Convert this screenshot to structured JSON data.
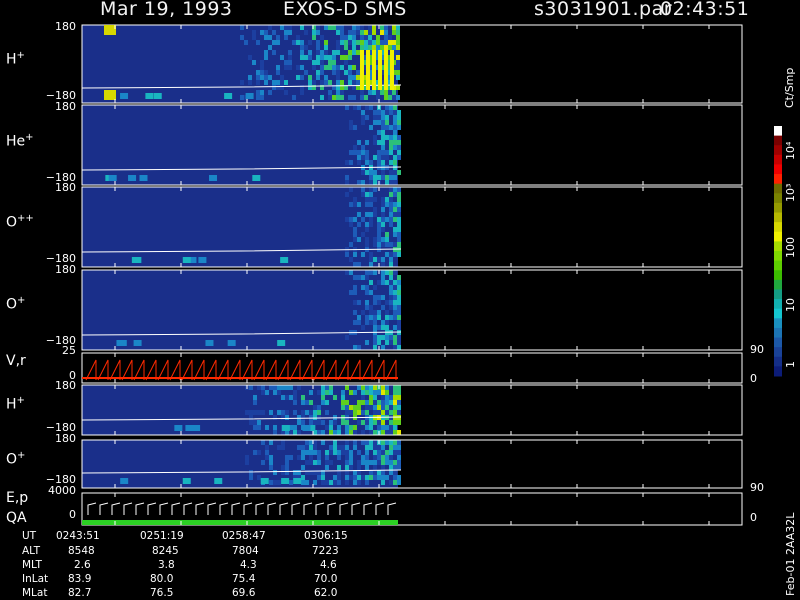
{
  "header": {
    "date": "Mar 19, 1993",
    "instrument": "EXOS-D SMS",
    "file": "s3031901.par",
    "time": "02:43:51"
  },
  "panels": [
    {
      "label": "H",
      "sup": "+",
      "top_tick": "180",
      "bottom_tick": "−180"
    },
    {
      "label": "He",
      "sup": "+",
      "top_tick": "180",
      "bottom_tick": "−180"
    },
    {
      "label": "O",
      "sup": "++",
      "top_tick": "180",
      "bottom_tick": "−180"
    },
    {
      "label": "O",
      "sup": "+",
      "top_tick": "180",
      "bottom_tick": "−180"
    },
    {
      "label": "V,r",
      "sup": "",
      "top_tick": "25",
      "bottom_tick": "0",
      "right_top": "90",
      "right_bottom": "0"
    },
    {
      "label": "H",
      "sup": "+",
      "top_tick": "180",
      "bottom_tick": "−180"
    },
    {
      "label": "O",
      "sup": "+",
      "top_tick": "180",
      "bottom_tick": "−180"
    },
    {
      "label": "E,p",
      "label2": "QA",
      "sup": "",
      "top_tick": "4000",
      "bottom_tick": "0",
      "right_top": "90",
      "right_bottom": "0"
    }
  ],
  "colorbar": {
    "unit": "Ct/Smp",
    "labels": [
      "10⁴",
      "10³",
      "100",
      "10",
      "1"
    ],
    "colors": [
      "#ffffff",
      "#7a0000",
      "#a00000",
      "#c80000",
      "#f00000",
      "#ff2000",
      "#6e6b00",
      "#7a8200",
      "#949a00",
      "#b6b800",
      "#d7d800",
      "#f0f000",
      "#a6dc00",
      "#80d800",
      "#5ece00",
      "#3cbc00",
      "#20a83e",
      "#149c84",
      "#12b0b0",
      "#14c6d0",
      "#1a90c0",
      "#1c74b4",
      "#1c58a8",
      "#1a4298",
      "#142e88",
      "#0c1c78"
    ]
  },
  "right_tag": "Feb-01 2AA32L",
  "footer": {
    "rows": [
      {
        "label": "UT",
        "values": [
          "0243:51",
          "0251:19",
          "0258:47",
          "0306:15"
        ]
      },
      {
        "label": "ALT",
        "values": [
          "8548",
          "8245",
          "7804",
          "7223"
        ]
      },
      {
        "label": "MLT",
        "values": [
          "2.6",
          "3.8",
          "4.3",
          "4.6"
        ]
      },
      {
        "label": "InLat",
        "values": [
          "83.9",
          "80.0",
          "75.4",
          "70.0"
        ]
      },
      {
        "label": "MLat",
        "values": [
          "82.7",
          "76.5",
          "69.6",
          "62.0"
        ]
      }
    ]
  },
  "chart_data": {
    "type": "heatmap",
    "x": [
      "0243:51",
      "0251:19",
      "0258:47",
      "0306:15"
    ],
    "spectrogram_panels": [
      {
        "species": "H+",
        "ylim": [
          -180,
          180
        ]
      },
      {
        "species": "He+",
        "ylim": [
          -180,
          180
        ]
      },
      {
        "species": "O++",
        "ylim": [
          -180,
          180
        ]
      },
      {
        "species": "O+",
        "ylim": [
          -180,
          180
        ]
      },
      {
        "species": "H+",
        "ylim": [
          -180,
          180
        ]
      },
      {
        "species": "O+",
        "ylim": [
          -180,
          180
        ]
      }
    ],
    "line_panels": [
      {
        "name": "V,r",
        "ylim": [
          0,
          25
        ],
        "right_ylim": [
          0,
          90
        ]
      },
      {
        "name": "E,p",
        "ylim": [
          0,
          4000
        ],
        "right_ylim": [
          0,
          90
        ]
      }
    ],
    "colorbar": {
      "unit": "Ct/Smp",
      "scale": "log",
      "range": [
        1,
        10000
      ]
    }
  }
}
